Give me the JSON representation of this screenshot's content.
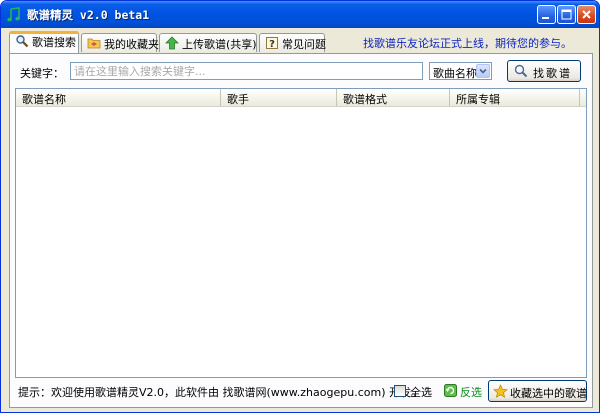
{
  "window": {
    "title": "歌谱精灵 v2.0 beta1",
    "icons": {
      "app": "music-note-icon",
      "minimize": "minimize-icon",
      "maximize": "maximize-icon",
      "close": "close-icon"
    }
  },
  "tabs": [
    {
      "label": "歌谱搜索",
      "icon": "search-icon",
      "active": true
    },
    {
      "label": "我的收藏夹",
      "icon": "folder-icon",
      "active": false
    },
    {
      "label": "上传歌谱(共享)",
      "icon": "upload-arrow-icon",
      "active": false
    },
    {
      "label": "常见问题",
      "icon": "help-icon",
      "active": false
    }
  ],
  "notice": "找歌谱乐友论坛正式上线，期待您的参与。",
  "search": {
    "label": "关键字：",
    "placeholder": "请在这里输入搜索关键字...",
    "value": "",
    "type_selected": "歌曲名称",
    "button_label": "找歌谱"
  },
  "table": {
    "columns": [
      "歌谱名称",
      "歌手",
      "歌谱格式",
      "所属专辑"
    ],
    "rows": []
  },
  "status": {
    "text": "提示：欢迎使用歌谱精灵V2.0，此软件由 找歌谱网(www.zhaogepu.com) 开发。",
    "select_all_label": "全选",
    "invert_label": "反选",
    "favorite_button_label": "收藏选中的歌谱"
  },
  "colors": {
    "titlebar": "#0054e3",
    "notice": "#0b23bf",
    "invert": "#0a8a1a",
    "tab_highlight": "#f1b33c"
  }
}
